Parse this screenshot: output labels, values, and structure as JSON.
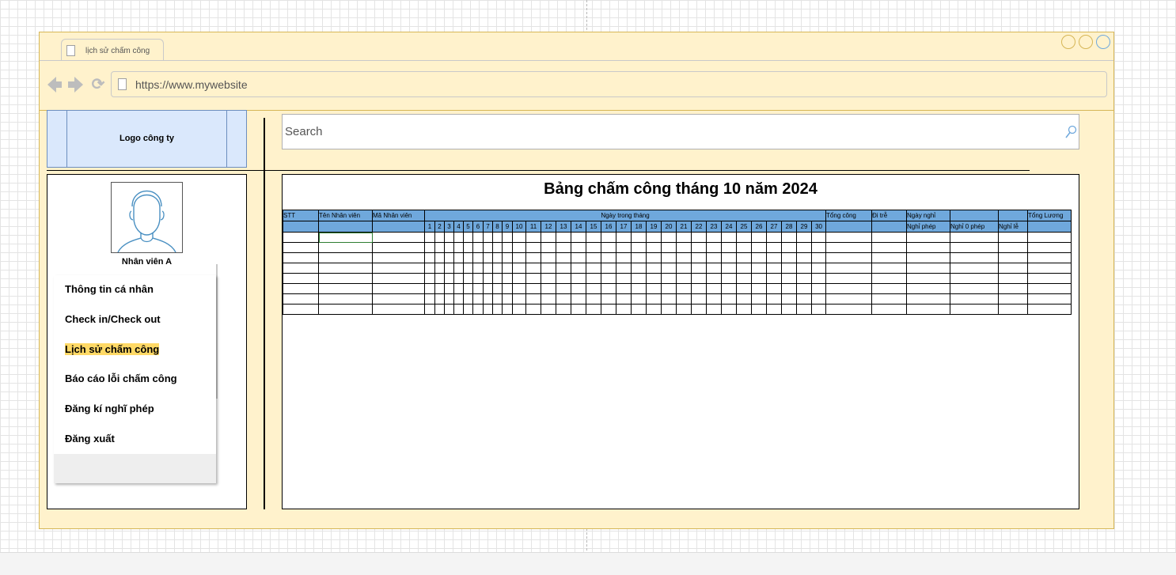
{
  "browser": {
    "tab_title": "lịch sử chấm công",
    "url": "https://www.mywebsite"
  },
  "logo": {
    "label": "Logo công ty"
  },
  "search": {
    "placeholder": "Search"
  },
  "user": {
    "name": "Nhân viên A"
  },
  "menu": {
    "items": [
      {
        "label": "Thông tin cá nhân",
        "active": false
      },
      {
        "label": "Check in/Check out",
        "active": false
      },
      {
        "label": "Lịch sử chấm công",
        "active": true
      },
      {
        "label": "Báo cáo lỗi chấm công",
        "active": false
      },
      {
        "label": "Đăng kí nghĩ phép",
        "active": false
      },
      {
        "label": "Đăng xuất",
        "active": false
      }
    ]
  },
  "timesheet": {
    "title": "Bảng chấm công tháng 10 năm 2024",
    "headers": {
      "stt": "STT",
      "employee_name": "Tên Nhân viên",
      "employee_id": "Mã Nhân viên",
      "days_in_month": "Ngày trong tháng",
      "total_work": "Tổng công",
      "late": "Đi trễ",
      "days_off": "Ngày nghỉ",
      "total_salary": "Tổng Lương"
    },
    "day_numbers": [
      "1",
      "2",
      "3",
      "4",
      "5",
      "6",
      "7",
      "8",
      "9",
      "10",
      "11",
      "12",
      "13",
      "14",
      "15",
      "16",
      "17",
      "18",
      "19",
      "20",
      "21",
      "22",
      "23",
      "24",
      "25",
      "26",
      "27",
      "28",
      "29",
      "30"
    ],
    "leave_types": [
      "Nghỉ phép",
      "Nghỉ 0 phép",
      "Nghỉ lễ"
    ],
    "empty_rows": 8
  },
  "colors": {
    "browser_bg": "#fff2cc",
    "logo_bg": "#dae8fc",
    "header_blue": "#6fa8dc",
    "active_highlight": "#ffd966"
  }
}
